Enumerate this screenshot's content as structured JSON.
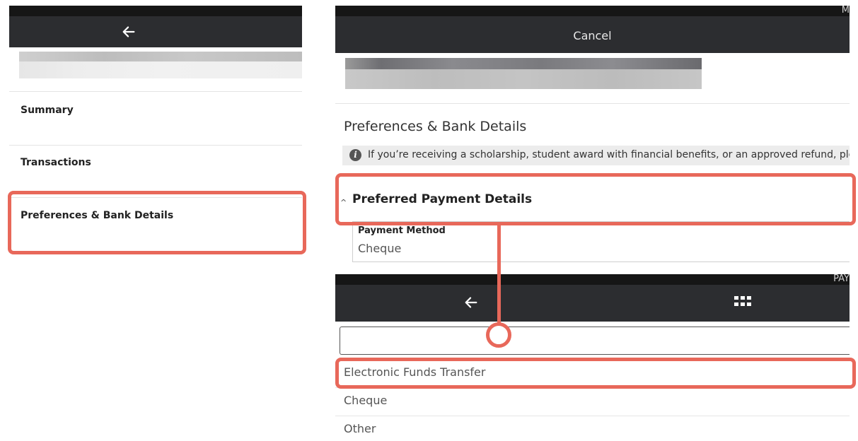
{
  "left_panel": {
    "nav_items": [
      {
        "label": "Summary"
      },
      {
        "label": "Transactions"
      },
      {
        "label": "Preferences & Bank Details"
      }
    ]
  },
  "top_right": {
    "strip_text": "M",
    "cancel_label": "Cancel",
    "section_title": "Preferences & Bank Details",
    "info_text": "If you’re receiving a scholarship, student award with financial benefits, or an approved refund, please",
    "preferred_payment_header": "Preferred Payment Details",
    "payment_method": {
      "label": "Payment Method",
      "value": "Cheque"
    }
  },
  "bottom_right": {
    "strip_text": "PAY",
    "search": {
      "value": "",
      "placeholder": ""
    },
    "options": [
      {
        "label": "Electronic Funds Transfer"
      },
      {
        "label": "Cheque"
      },
      {
        "label": "Other"
      }
    ]
  },
  "icons": {
    "back": "back-arrow-icon",
    "grid": "grid-icon",
    "info": "info-icon",
    "caret": "chevron-up-icon"
  },
  "colors": {
    "nav_bar": "#2c2d30",
    "top_strip": "#161616",
    "highlight": "#e8685a"
  }
}
